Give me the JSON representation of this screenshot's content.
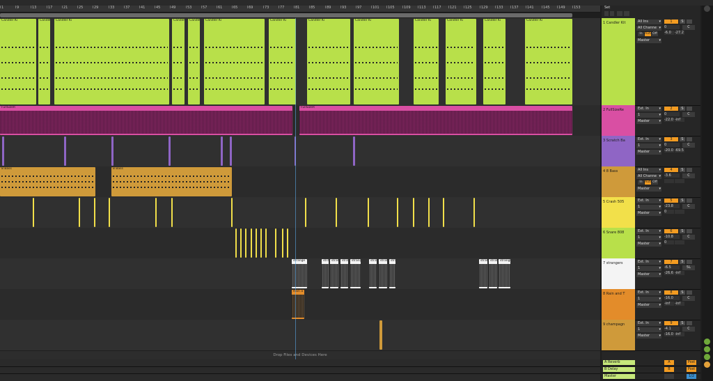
{
  "ruler": {
    "bars": [
      "1",
      "9",
      "13",
      "17",
      "21",
      "25",
      "29",
      "33",
      "37",
      "41",
      "45",
      "49",
      "53",
      "57",
      "61",
      "65",
      "69",
      "73",
      "77",
      "81",
      "85",
      "89",
      "93",
      "97",
      "101",
      "105",
      "109",
      "113",
      "117",
      "121",
      "125",
      "129",
      "133",
      "137",
      "141",
      "145",
      "149",
      "153"
    ]
  },
  "set_label": "Set",
  "drop_text": "Drop Files and Devices Here",
  "tracks": [
    {
      "id": 1,
      "name": "1 Candler Kit",
      "color": "#b8e04a",
      "input": "All Ins",
      "channel": "All Channe",
      "monitor": [
        "In",
        "Auto",
        "Off"
      ],
      "output": "Master",
      "number": "1",
      "vol": "0",
      "pan": "C",
      "vol2": "-6.0",
      "peak": "-27.2",
      "clip_label": "Candler Ki"
    },
    {
      "id": 2,
      "name": "2 FullSizeRe",
      "color": "#d94fa3",
      "input": "Ext. In",
      "channel": "1",
      "monitor": [],
      "output": "Master",
      "number": "2",
      "vol": "0",
      "pan": "C",
      "vol2": "-22.0",
      "peak": "-inf",
      "clip_label": "FullSizeR"
    },
    {
      "id": 3,
      "name": "3 Scratch Ba",
      "color": "#8f65c5",
      "input": "Ext. In",
      "channel": "1",
      "monitor": [],
      "output": "Master",
      "number": "3",
      "vol": "0",
      "pan": "C",
      "vol2": "-20.0",
      "peak": "-69.5",
      "clip_label": ""
    },
    {
      "id": 4,
      "name": "4 8 Bass",
      "color": "#cf9a3a",
      "input": "All Ins",
      "channel": "All Channe",
      "monitor": [
        "In",
        "Auto",
        "Off"
      ],
      "output": "Master",
      "number": "4",
      "vol": "-3.6",
      "pan": "C",
      "vol2": "",
      "peak": "",
      "clip_label": "8 Bass"
    },
    {
      "id": 5,
      "name": "5 Crash 505",
      "color": "#f2e04a",
      "input": "Ext. In",
      "channel": "1",
      "monitor": [],
      "output": "Master",
      "number": "5",
      "vol": "-23.8",
      "pan": "C",
      "vol2": "0",
      "peak": "",
      "clip_label": ""
    },
    {
      "id": 6,
      "name": "6 Snare 808",
      "color": "#b8e04a",
      "input": "Ext. In",
      "channel": "1",
      "monitor": [],
      "output": "Master",
      "number": "6",
      "vol": "-10.8",
      "pan": "C",
      "vol2": "0",
      "peak": "",
      "clip_label": ""
    },
    {
      "id": 7,
      "name": "7 strangers",
      "color": "#f4f4f4",
      "input": "Ext. In",
      "channel": "1",
      "monitor": [],
      "output": "Master",
      "number": "7",
      "vol": "-6.5",
      "pan": "5L",
      "vol2": "-26.6",
      "peak": "-inf",
      "clip_label": "strange"
    },
    {
      "id": 8,
      "name": "8 Rain and T",
      "color": "#e38c2a",
      "input": "Ext. In",
      "channel": "1",
      "monitor": [],
      "output": "Master",
      "number": "8",
      "vol": "-16.0",
      "pan": "C",
      "vol2": "-inf",
      "peak": "-inf",
      "clip_label": "Rain a"
    },
    {
      "id": 9,
      "name": "9 champagn",
      "color": "#cf9a3a",
      "input": "Ext. In",
      "channel": "1",
      "monitor": [],
      "output": "Master",
      "number": "9",
      "vol": "-4.1",
      "pan": "C",
      "vol2": "-16.0",
      "peak": "-inf",
      "clip_label": ""
    }
  ],
  "returns": [
    {
      "name": "A Reverb",
      "letter": "A",
      "post": "Post"
    },
    {
      "name": "B Delay",
      "letter": "B",
      "post": "Post"
    },
    {
      "name": "Master",
      "letter": "",
      "post": "1/2"
    }
  ]
}
